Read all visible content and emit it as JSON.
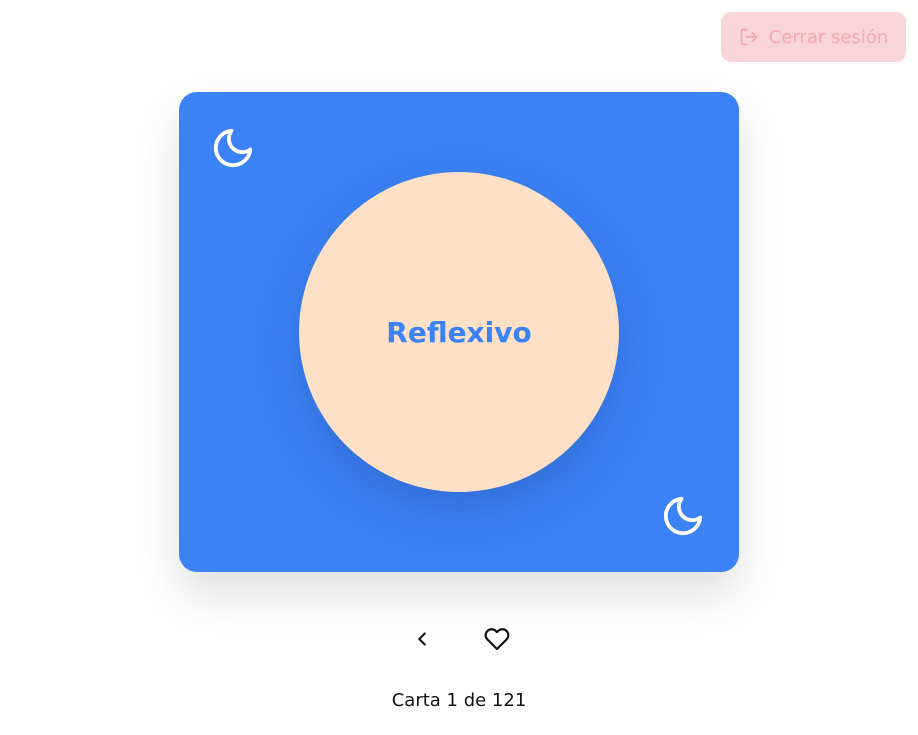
{
  "header": {
    "logout_label": "Cerrar sesión",
    "logout_icon": "logout-icon"
  },
  "card": {
    "word": "Reflexivo",
    "corner_icon": "moon-icon",
    "colors": {
      "card_background": "#3b82f6",
      "circle_background": "#fde0c5",
      "word": "#3b82f6"
    }
  },
  "controls": {
    "previous_icon": "chevron-left-icon",
    "favorite_icon": "heart-icon"
  },
  "footer": {
    "counter": "Carta 1 de 121"
  }
}
